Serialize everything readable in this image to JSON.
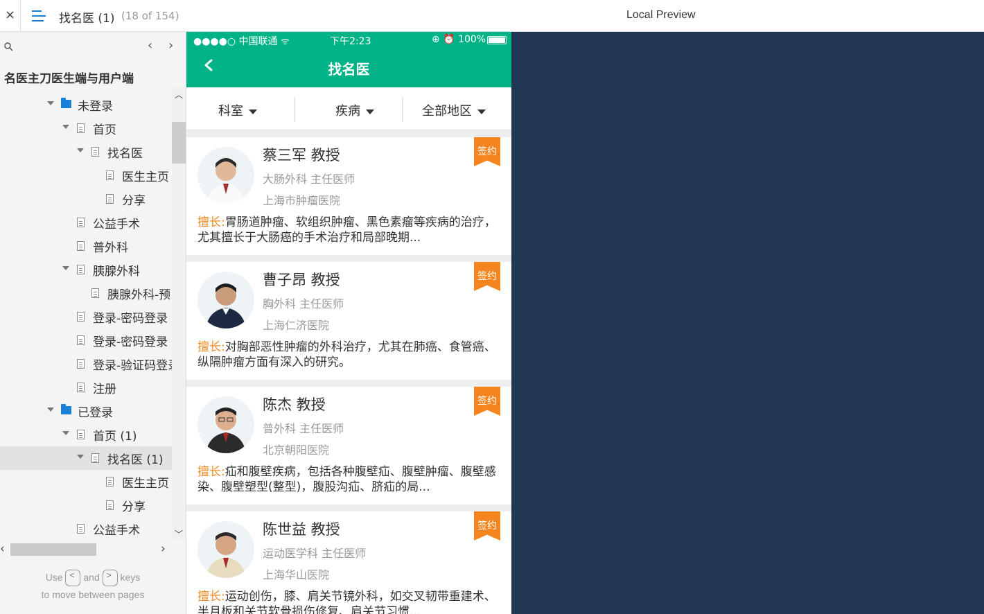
{
  "topbar": {
    "close_label": "×",
    "page_title": "找名医 (1)",
    "page_count": "(18 of 154)",
    "preview_title": "Local Preview"
  },
  "sidebar": {
    "prev_label": "‹",
    "next_label": "›",
    "project_title": "名医主刀医生端与用户端",
    "tree": [
      {
        "label": "未登录",
        "type": "folder"
      },
      {
        "label": "首页",
        "type": "page"
      },
      {
        "label": "找名医",
        "type": "page"
      },
      {
        "label": "医生主页",
        "type": "page"
      },
      {
        "label": "分享",
        "type": "page"
      },
      {
        "label": "公益手术",
        "type": "page"
      },
      {
        "label": "普外科",
        "type": "page"
      },
      {
        "label": "胰腺外科",
        "type": "page"
      },
      {
        "label": "胰腺外科-预",
        "type": "page"
      },
      {
        "label": "登录-密码登录",
        "type": "page"
      },
      {
        "label": "登录-密码登录",
        "type": "page"
      },
      {
        "label": "登录-验证码登录",
        "type": "page"
      },
      {
        "label": "注册",
        "type": "page"
      },
      {
        "label": "已登录",
        "type": "folder"
      },
      {
        "label": "首页 (1)",
        "type": "page"
      },
      {
        "label": "找名医 (1)",
        "type": "page",
        "selected": true
      },
      {
        "label": "医生主页",
        "type": "page"
      },
      {
        "label": "分享",
        "type": "page"
      },
      {
        "label": "公益手术",
        "type": "page"
      }
    ],
    "hint": {
      "use": "Use",
      "and": "and",
      "keys": "keys",
      "line2": "to move between pages",
      "key_prev": "<",
      "key_next": ">"
    }
  },
  "phone": {
    "status": {
      "carrier": "●●●●○ 中国联通 ᯤ",
      "time": "下午2:23",
      "battery": "⊕ ⏰ 100%"
    },
    "nav_title": "找名医",
    "filters": [
      "科室",
      "疾病",
      "全部地区"
    ],
    "skill_label": "擅长:",
    "badge_label": "签约",
    "doctors": [
      {
        "name": "蔡三军 教授",
        "dept": "大肠外科  主任医师",
        "hospital": "上海市肿瘤医院",
        "skill": "胃肠道肿瘤、软组织肿瘤、黑色素瘤等疾病的治疗，尤其擅长于大肠癌的手术治疗和局部晚期..."
      },
      {
        "name": "曹子昂 教授",
        "dept": "胸外科 主任医师",
        "hospital": "上海仁济医院",
        "skill": "对胸部恶性肿瘤的外科治疗，尤其在肺癌、食管癌、纵隔肿瘤方面有深入的研究。"
      },
      {
        "name": "陈杰 教授",
        "dept": "普外科 主任医师",
        "hospital": "北京朝阳医院",
        "skill": "疝和腹壁疾病，包括各种腹壁疝、腹壁肿瘤、腹壁感染、腹壁塑型(整型)，腹股沟疝、脐疝的局..."
      },
      {
        "name": "陈世益 教授",
        "dept": "运动医学科 主任医师",
        "hospital": "上海华山医院",
        "skill": "运动创伤，膝、肩关节镜外科，如交叉韧带重建术、半月板和关节软骨损伤修复、肩关节习惯..."
      }
    ]
  },
  "colors": {
    "accent": "#00b386",
    "badge": "#f5861f",
    "preview_bg": "#1f3752",
    "folder": "#1a7fd6"
  }
}
